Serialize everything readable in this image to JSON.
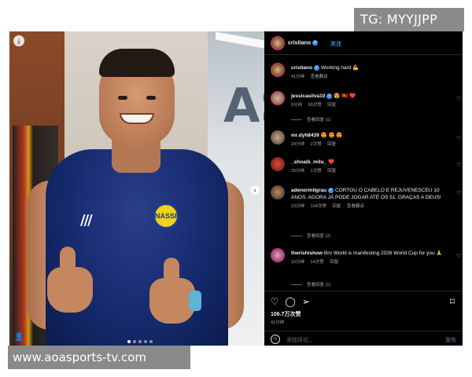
{
  "watermarks": {
    "top": "TG: MYYJJPP",
    "bottom": "www.aoasports-tv.com"
  },
  "photo": {
    "download_icon": "download-icon",
    "next_icon": "chevron-right-icon",
    "carousel_slide_count": 5,
    "carousel_active_index": 0,
    "bg_letters": "AS"
  },
  "header": {
    "username": "cristiano",
    "follow": "关注"
  },
  "caption": {
    "username": "cristiano",
    "text": "Working hard 💪",
    "time": "41分钟",
    "translate": "查看翻译"
  },
  "comments": [
    {
      "username": "jessicasilva10",
      "text": "😍 🇵🇹 ❤️",
      "time": "5分钟",
      "likes": "90次赞",
      "reply": "回复",
      "view_replies": "查看回复 (1)"
    },
    {
      "username": "mr.dyh8439",
      "text": "😍 😍 😍",
      "time": "24分钟",
      "likes": "2次赞",
      "reply": "回复"
    },
    {
      "username": "_shoaib_milu_",
      "text": "❤️",
      "time": "25分钟",
      "likes": "1次赞",
      "reply": "回复"
    },
    {
      "username": "adenormilgrau",
      "text": "CORTOU O CABELO E REJUVENESCEU 10 ANOS. AGORA JÁ PODE JOGAR ATÉ OS 51. GRAÇAS A DEUS!",
      "time": "23分钟",
      "likes": "104次赞",
      "reply": "回复",
      "translate": "查看翻译",
      "view_replies": "查看回复 (2)"
    },
    {
      "username": "therishishow",
      "text": "Bro World is manifesting 2026 World Cup for you 🙏",
      "time": "15分钟",
      "likes": "14次赞",
      "reply": "回复",
      "view_replies": "查看回复 (1)"
    }
  ],
  "actions": {
    "likes": "106.7万次赞",
    "time": "41分钟",
    "add_comment_placeholder": "添加评论...",
    "post_label": "发布"
  },
  "colors": {
    "accent": "#3897f0",
    "background": "#000000",
    "jersey": "#152a6d"
  }
}
